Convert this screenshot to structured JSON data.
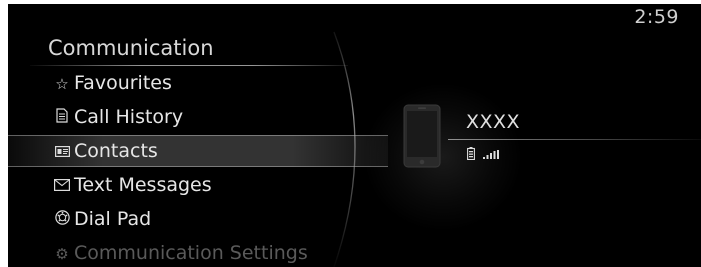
{
  "status": {
    "clock": "2:59"
  },
  "menu": {
    "title": "Communication",
    "items": [
      {
        "icon": "star-icon",
        "glyph": "☆",
        "label": "Favourites",
        "selected": false,
        "disabled": false
      },
      {
        "icon": "document-icon",
        "glyph": "🗎",
        "label": "Call History",
        "selected": false,
        "disabled": false
      },
      {
        "icon": "contact-card-icon",
        "glyph": "▤",
        "label": "Contacts",
        "selected": true,
        "disabled": false
      },
      {
        "icon": "envelope-icon",
        "glyph": "✉",
        "label": "Text Messages",
        "selected": false,
        "disabled": false
      },
      {
        "icon": "dial-pad-icon",
        "glyph": "Ⓐ",
        "label": "Dial Pad",
        "selected": false,
        "disabled": false
      },
      {
        "icon": "gear-icon",
        "glyph": "⚙",
        "label": "Communication Settings",
        "selected": false,
        "disabled": true
      }
    ]
  },
  "device": {
    "name": "XXXX",
    "icon": "smartphone-icon",
    "battery_icon": "battery-icon",
    "signal_icon": "signal-bars-icon",
    "signal_bars": 4
  },
  "colors": {
    "background": "#000000",
    "text": "#e6e6e6",
    "dim_text": "#5a5a5a"
  }
}
